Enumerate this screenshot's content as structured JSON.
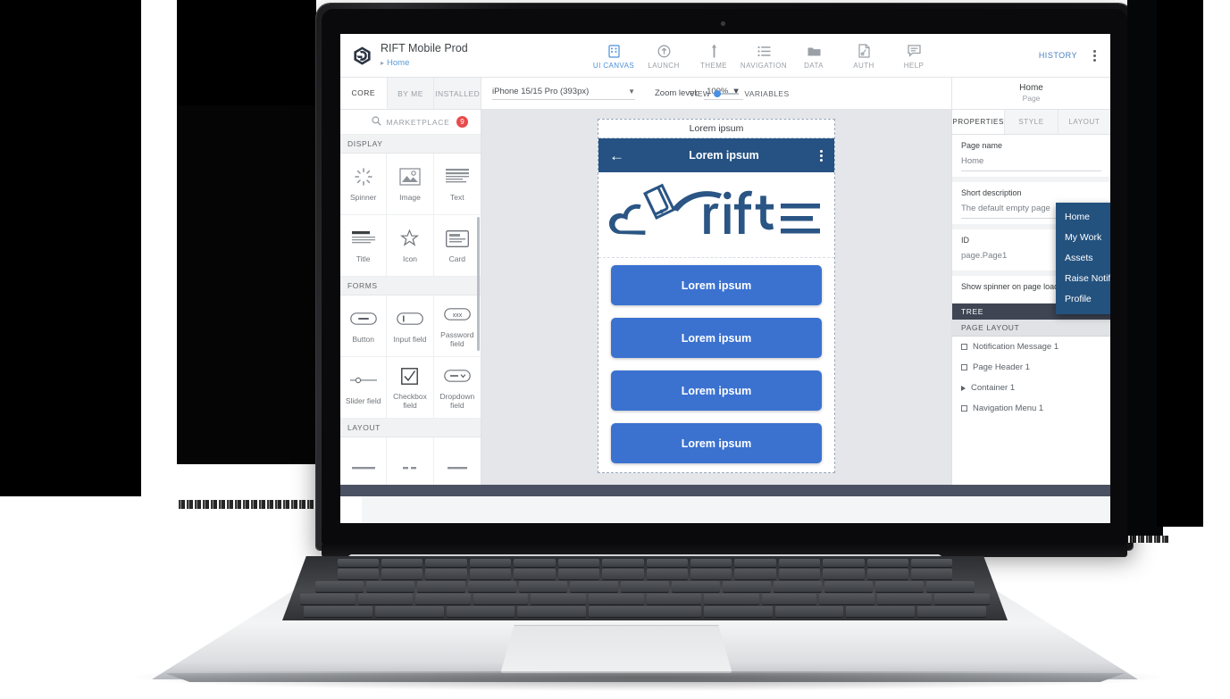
{
  "topbar": {
    "app_title": "RIFT Mobile Prod",
    "breadcrumb": "Home",
    "nav_items": [
      {
        "label": "UI CANVAS",
        "icon": "canvas-icon",
        "active": true
      },
      {
        "label": "LAUNCH",
        "icon": "launch-icon",
        "active": false
      },
      {
        "label": "THEME",
        "icon": "theme-icon",
        "active": false
      },
      {
        "label": "NAVIGATION",
        "icon": "navigation-icon",
        "active": false
      },
      {
        "label": "DATA",
        "icon": "folder-icon",
        "active": false
      },
      {
        "label": "AUTH",
        "icon": "auth-document-icon",
        "active": false
      },
      {
        "label": "HELP",
        "icon": "chat-help-icon",
        "active": false
      }
    ],
    "history_label": "HISTORY",
    "overflow_icon": "kebab-menu-icon"
  },
  "subbar": {
    "palette_tabs": [
      {
        "label": "CORE",
        "active": true
      },
      {
        "label": "BY ME",
        "active": false
      },
      {
        "label": "INSTALLED",
        "active": false
      }
    ],
    "device_select": "iPhone 15/15 Pro (393px)",
    "zoom_label": "Zoom level:",
    "zoom_value": "100%",
    "view_label": "VIEW",
    "variables_label": "VARIABLES",
    "page_name": "Home",
    "page_kind": "Page"
  },
  "palette": {
    "marketplace_label": "MARKETPLACE",
    "marketplace_badge": "9",
    "sections": [
      {
        "title": "DISPLAY",
        "components": [
          {
            "name": "Spinner",
            "icon": "spinner-icon"
          },
          {
            "name": "Image",
            "icon": "image-icon"
          },
          {
            "name": "Text",
            "icon": "text-lines-icon"
          },
          {
            "name": "Title",
            "icon": "title-icon"
          },
          {
            "name": "Icon",
            "icon": "star-icon"
          },
          {
            "name": "Card",
            "icon": "card-icon"
          }
        ]
      },
      {
        "title": "FORMS",
        "components": [
          {
            "name": "Button",
            "icon": "button-icon"
          },
          {
            "name": "Input field",
            "icon": "input-field-icon"
          },
          {
            "name": "Password field",
            "icon": "password-field-icon"
          },
          {
            "name": "Slider field",
            "icon": "slider-icon"
          },
          {
            "name": "Checkbox field",
            "icon": "checkbox-icon"
          },
          {
            "name": "Dropdown field",
            "icon": "dropdown-icon"
          }
        ]
      },
      {
        "title": "LAYOUT",
        "components": [
          {
            "name": "",
            "icon": "layout-icon-1"
          },
          {
            "name": "",
            "icon": "layout-icon-2"
          },
          {
            "name": "",
            "icon": "layout-icon-3"
          }
        ]
      }
    ]
  },
  "canvas": {
    "notification_text": "Lorem ipsum",
    "header_title": "Lorem ipsum",
    "back_icon": "back-arrow-icon",
    "header_overflow_icon": "kebab-menu-icon",
    "logo_alt": "rift-logo",
    "buttons": [
      "Lorem ipsum",
      "Lorem ipsum",
      "Lorem ipsum",
      "Lorem ipsum"
    ],
    "nav_menu": [
      "Home",
      "My Work",
      "Assets",
      "Raise Notification",
      "Profile"
    ]
  },
  "properties": {
    "tabs": [
      {
        "label": "PROPERTIES",
        "active": true
      },
      {
        "label": "STYLE",
        "active": false
      },
      {
        "label": "LAYOUT",
        "active": false
      }
    ],
    "fields": [
      {
        "label": "Page name",
        "value": "Home"
      },
      {
        "label": "Short description",
        "value": "The default empty page"
      },
      {
        "label": "ID",
        "value": "page.Page1"
      }
    ],
    "spinner_label": "Show spinner on page load",
    "tree_header": "TREE",
    "tree_section": "PAGE LAYOUT",
    "tree_nodes": [
      {
        "label": "Notification Message 1",
        "marker": "box"
      },
      {
        "label": "Page Header 1",
        "marker": "box"
      },
      {
        "label": "Container 1",
        "marker": "triangle"
      },
      {
        "label": "Navigation Menu 1",
        "marker": "box"
      }
    ]
  },
  "colors": {
    "accent_blue": "#4a90d9",
    "brand_navy": "#265283",
    "button_blue": "#3b72d0",
    "menu_navy": "#24527f",
    "badge_red": "#e94b4b",
    "dark_bar": "#4a5162"
  }
}
